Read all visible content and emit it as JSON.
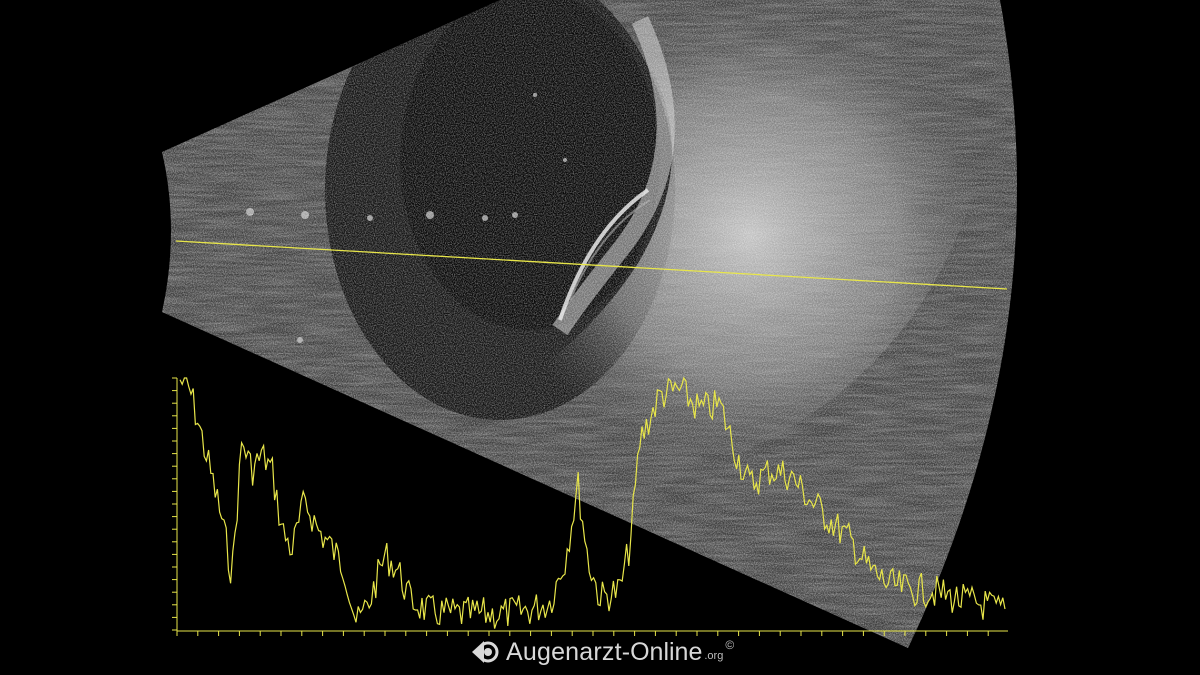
{
  "scan": {
    "scan_description": "",
    "colors": {
      "background": "#000000",
      "trace": "#e8e64a",
      "tissue": "#bfbfbf"
    }
  },
  "watermark": {
    "icon": "eye-logo-icon",
    "brand": "Augenarzt",
    "dash": "-",
    "brand2": "Online",
    "tld": ".org",
    "copyright": "©"
  }
}
